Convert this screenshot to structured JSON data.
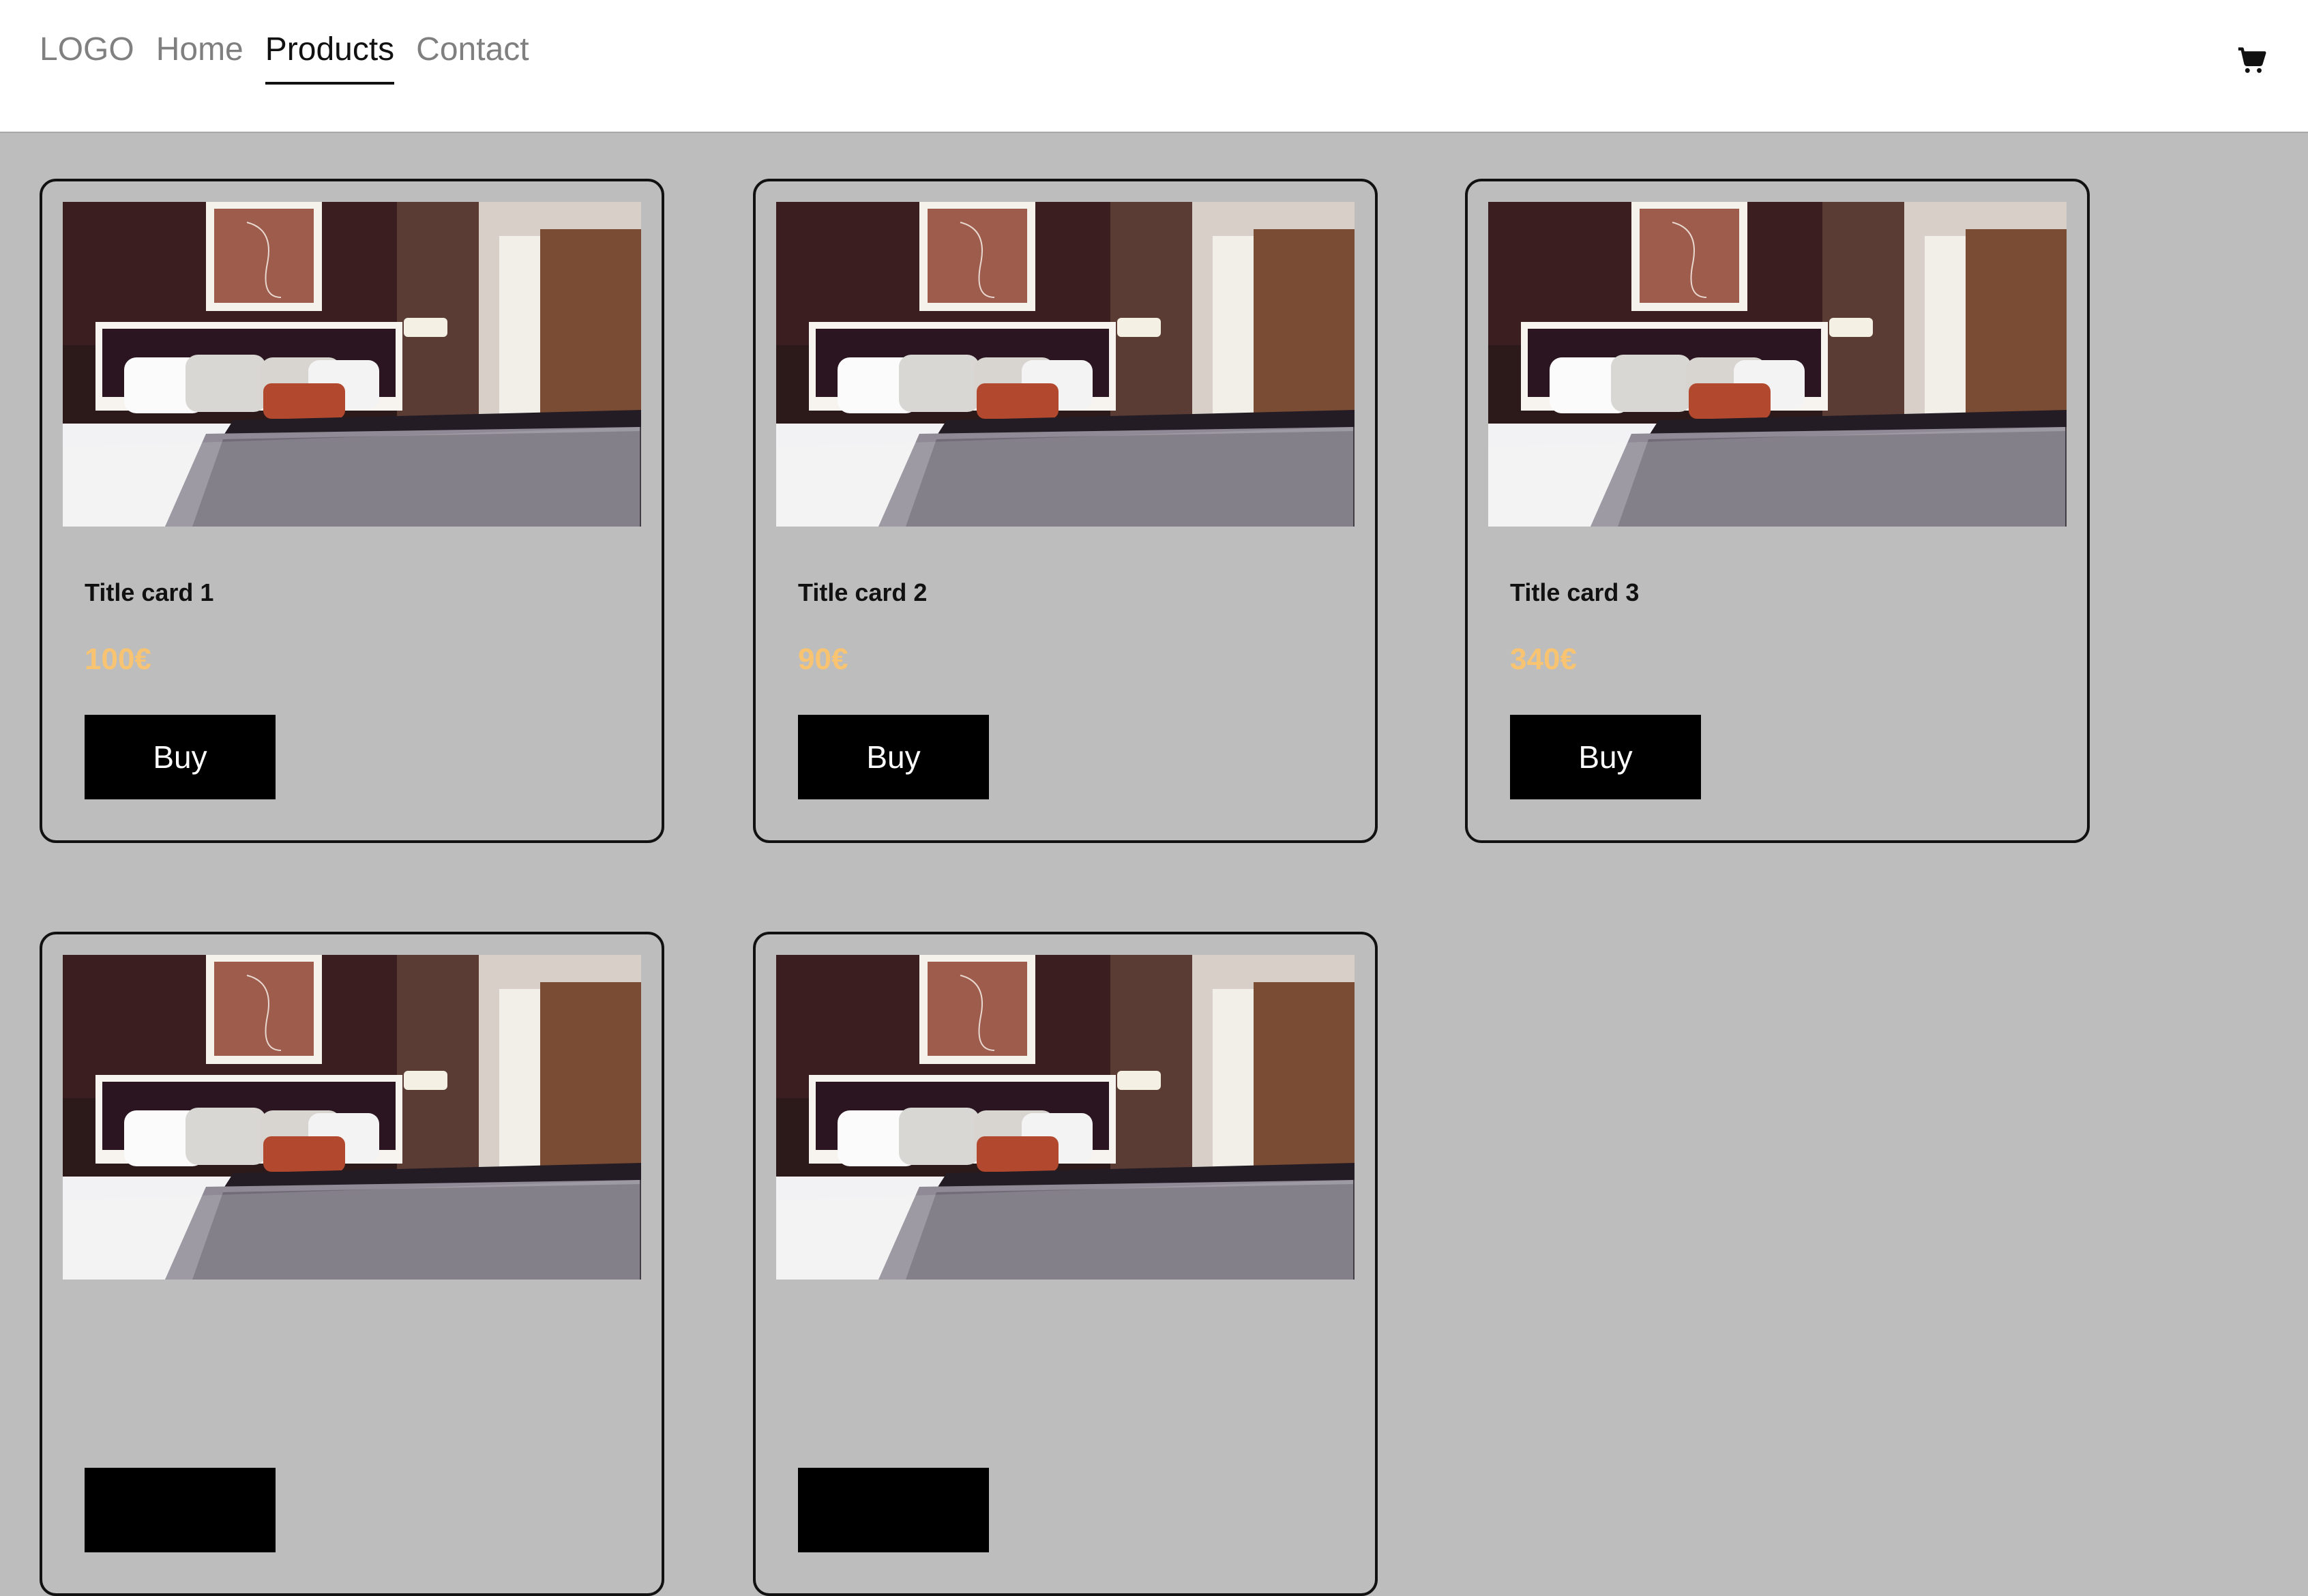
{
  "nav": {
    "logo": "LOGO",
    "links": [
      {
        "label": "Home"
      },
      {
        "label": "Products",
        "active": true
      },
      {
        "label": "Contact"
      }
    ],
    "cart_icon": "shopping-cart-icon"
  },
  "products": [
    {
      "title": "Title card 1",
      "price": "100€",
      "button": "Buy"
    },
    {
      "title": "Title card 2",
      "price": "90€",
      "button": "Buy"
    },
    {
      "title": "Title card 3",
      "price": "340€",
      "button": "Buy"
    },
    {
      "title": "",
      "price": "",
      "button": ""
    },
    {
      "title": "",
      "price": "",
      "button": ""
    }
  ],
  "colors": {
    "background": "#bdbdbd",
    "price": "#f8c471",
    "button_bg": "#000000",
    "button_text": "#ffffff"
  }
}
